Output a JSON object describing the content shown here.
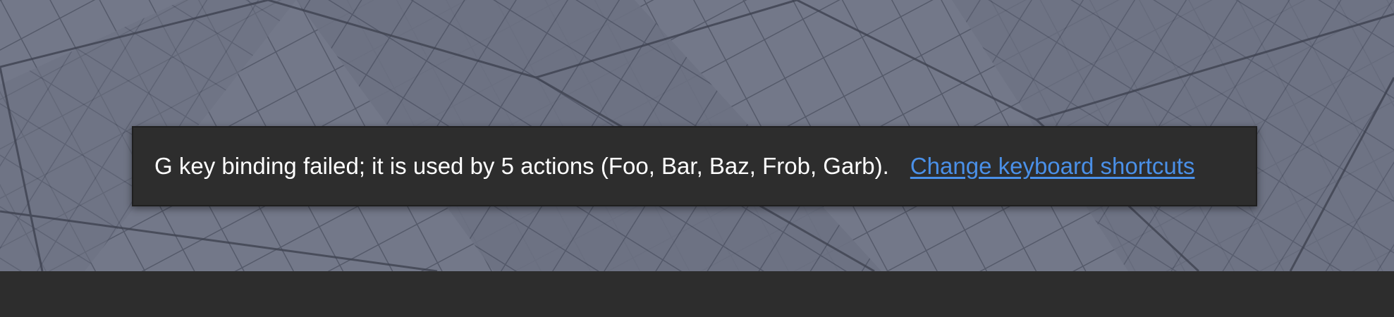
{
  "notification": {
    "message": "G key binding failed; it is used by 5 actions (Foo, Bar, Baz, Frob, Garb).",
    "link_label": "Change keyboard shortcuts"
  },
  "colors": {
    "viewport_bg": "#6f7485",
    "grid_line": "#4f5463",
    "toast_bg": "#2d2d2d",
    "toast_text": "#ffffff",
    "link": "#4a90e8",
    "bottom_bar": "#2d2d2d"
  }
}
